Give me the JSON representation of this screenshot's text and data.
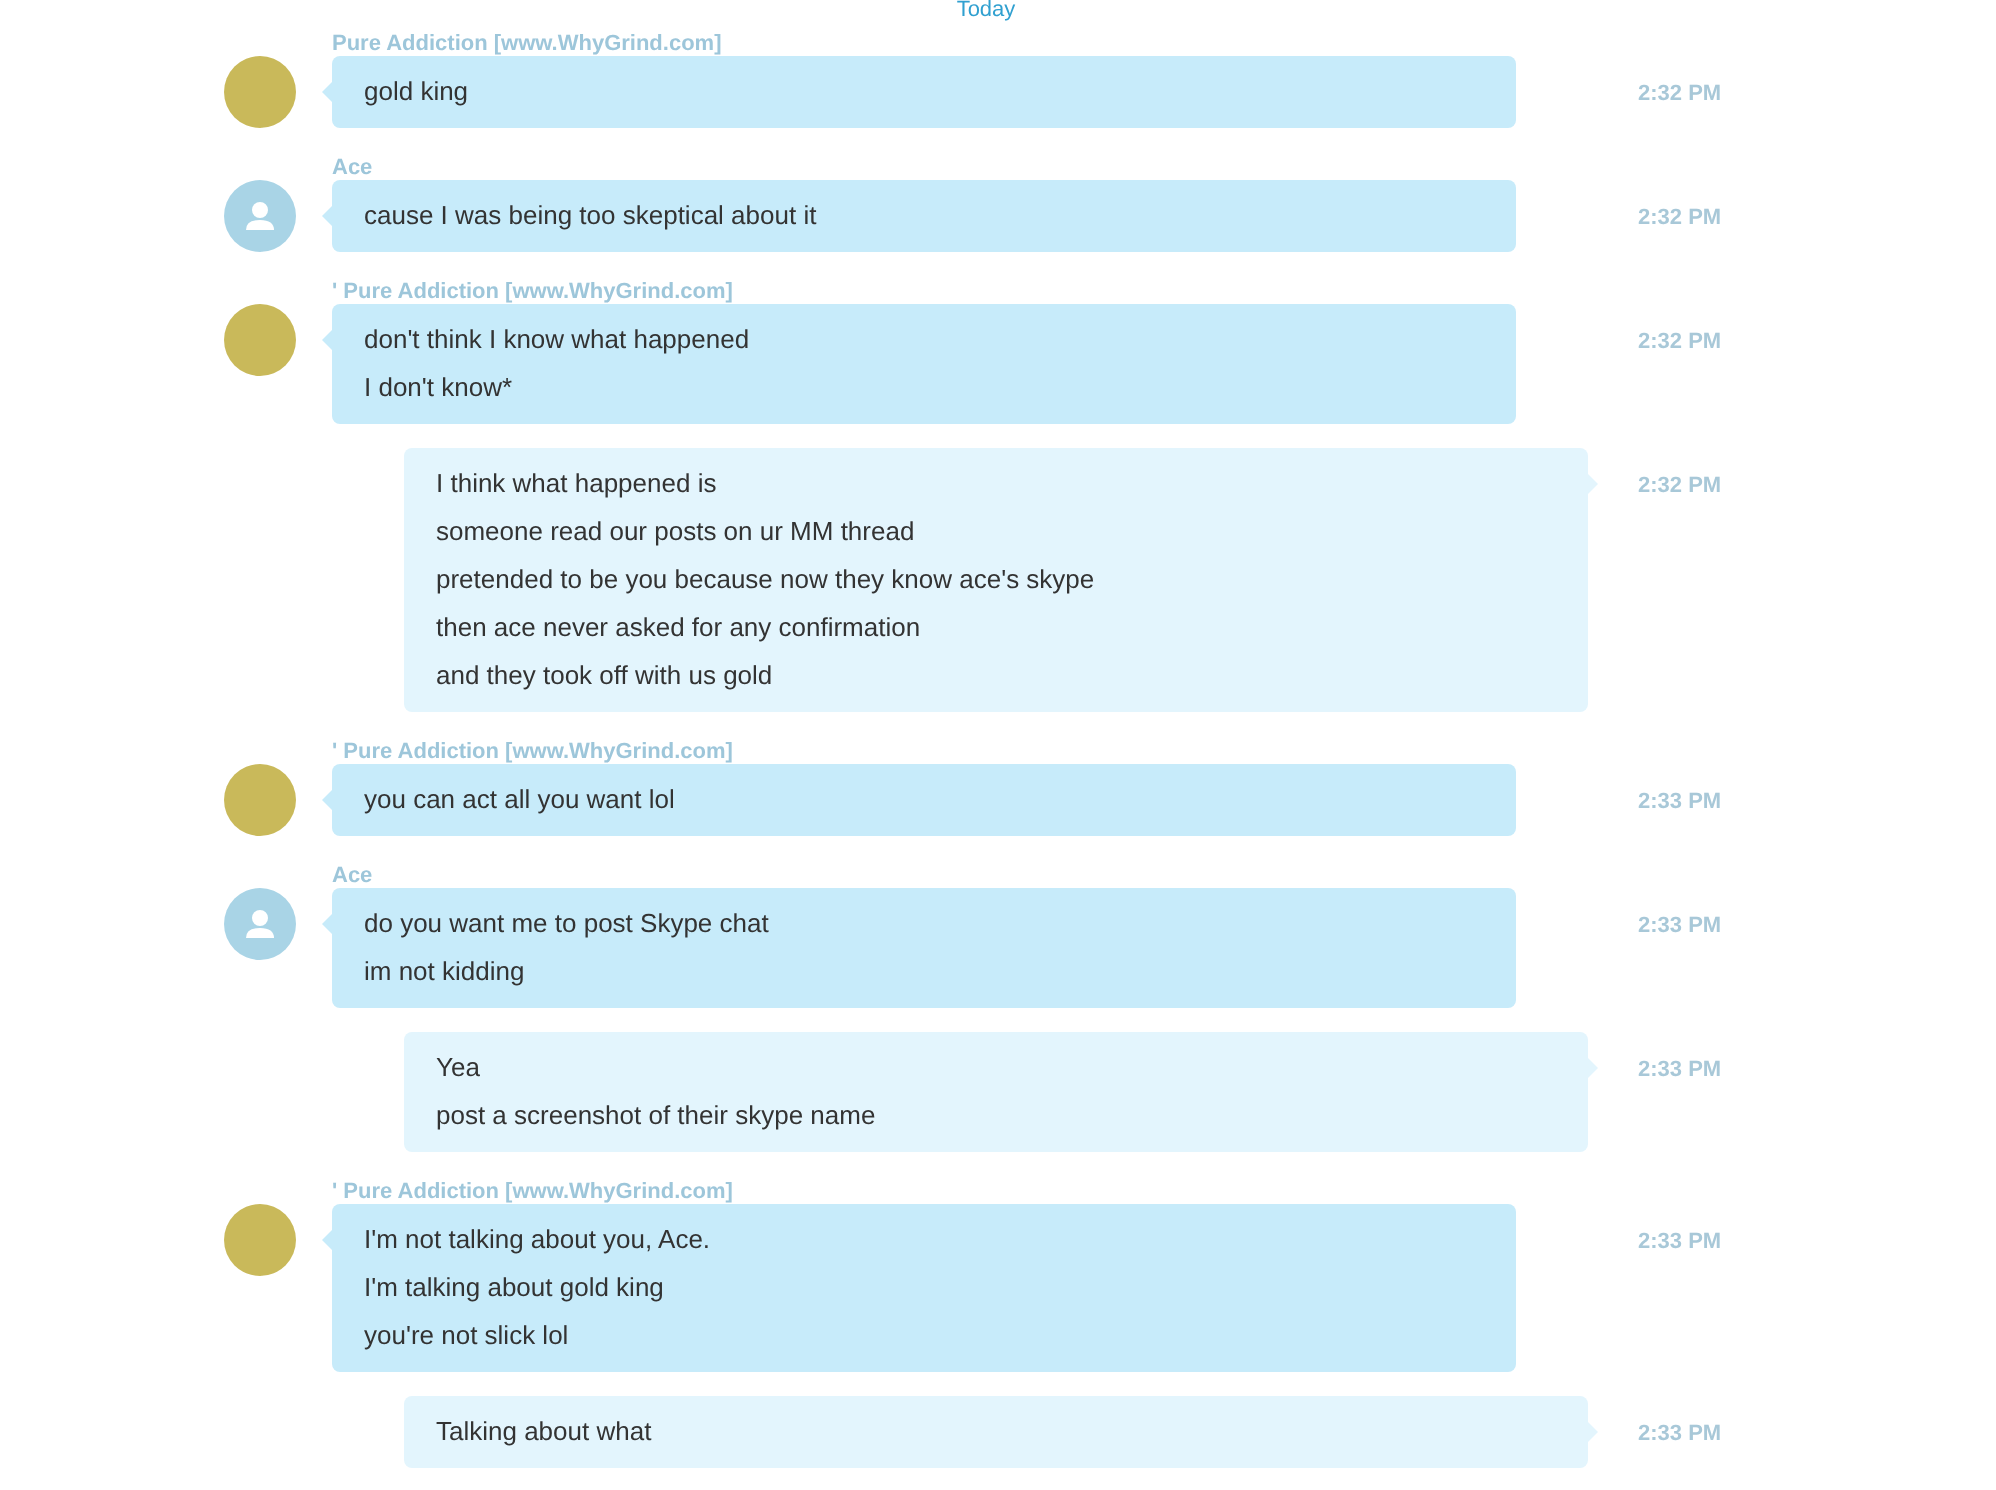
{
  "date_divider": "Today",
  "messages": [
    {
      "kind": "incoming",
      "sender": "Pure Addiction [www.WhyGrind.com]",
      "avatar": {
        "kind": "picture"
      },
      "lines": [
        "gold king"
      ],
      "time": "2:32 PM"
    },
    {
      "kind": "incoming",
      "sender": "Ace",
      "avatar": {
        "kind": "default"
      },
      "lines": [
        "cause I was being too skeptical about it"
      ],
      "time": "2:32 PM"
    },
    {
      "kind": "incoming",
      "sender": "' Pure Addiction [www.WhyGrind.com]",
      "avatar": {
        "kind": "picture"
      },
      "lines": [
        "don't think I know what happened",
        "I don't know*"
      ],
      "time": "2:32 PM"
    },
    {
      "kind": "outgoing",
      "lines": [
        "I think what happened is",
        "someone read our posts on ur MM thread",
        "pretended to be you because now they know ace's skype",
        "then ace never asked for any confirmation",
        "and they took off with us gold"
      ],
      "time": "2:32 PM"
    },
    {
      "kind": "incoming",
      "sender": "' Pure Addiction [www.WhyGrind.com]",
      "avatar": {
        "kind": "picture"
      },
      "lines": [
        "you can act all you want lol"
      ],
      "time": "2:33 PM"
    },
    {
      "kind": "incoming",
      "sender": "Ace",
      "avatar": {
        "kind": "default"
      },
      "lines": [
        "do you want me to post Skype chat",
        "im not kidding"
      ],
      "time": "2:33 PM"
    },
    {
      "kind": "outgoing",
      "lines": [
        "Yea",
        "post a screenshot of their skype name"
      ],
      "time": "2:33 PM"
    },
    {
      "kind": "incoming",
      "sender": "' Pure Addiction [www.WhyGrind.com]",
      "avatar": {
        "kind": "picture"
      },
      "lines": [
        "I'm not talking about you, Ace.",
        "I'm talking about gold king",
        "you're not slick lol"
      ],
      "time": "2:33 PM"
    },
    {
      "kind": "outgoing",
      "lines": [
        "Talking about what"
      ],
      "time": "2:33 PM"
    }
  ]
}
